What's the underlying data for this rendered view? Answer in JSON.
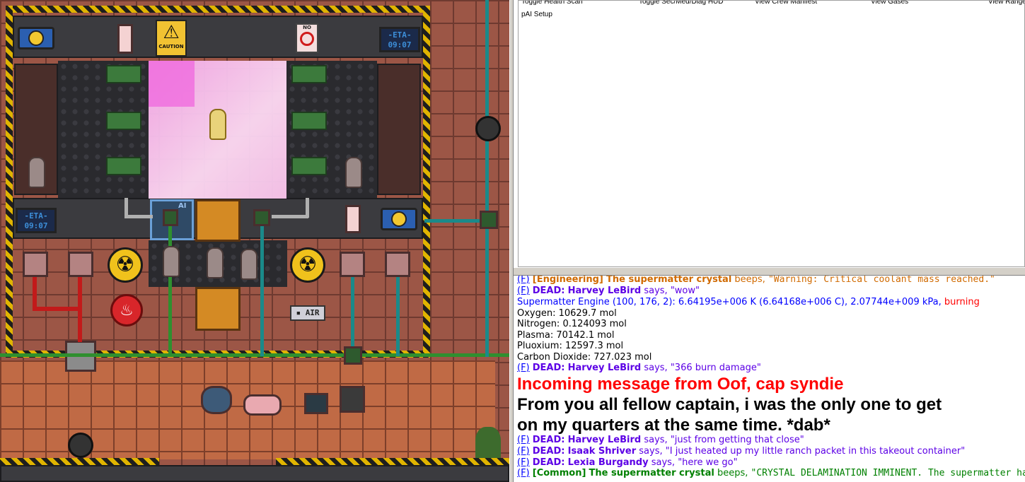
{
  "game": {
    "eta_label": "ETA",
    "eta_time": "09:07",
    "caution_label": "CAUTION",
    "no_smoking_label": "NO",
    "air_label": "AIR",
    "ai_label": "AI"
  },
  "verbs": {
    "row1": [
      "Toggle Health Scan",
      "Toggle Sec/Med/Diag HUD",
      "View Crew Manifest",
      "View Gases",
      "View Range"
    ],
    "row2": [
      "pAI Setup"
    ]
  },
  "chat": {
    "f_link": "(F)",
    "dead_prefix": "DEAD:",
    "msg1_channel": "[Engineering]",
    "msg1_speaker": "The supermatter crystal",
    "msg1_verb": "beeps,",
    "msg1_text": "\"Warning: Critical coolant mass reached.\"",
    "msg2_name": "Harvey LeBird",
    "msg2_verb": "says,",
    "msg2_text": "\"wow\"",
    "scan_head": "Supermatter Engine (100, 176, 2): 6.64195e+006 K (6.64168e+006 C), 2.07744e+009 kPa,",
    "scan_status": "burning",
    "gases": [
      "Oxygen: 10629.7 mol",
      "Nitrogen: 0.124093 mol",
      "Plasma: 70142.1 mol",
      "Pluoxium: 12597.3 mol",
      "Carbon Dioxide: 727.023 mol"
    ],
    "msg3_name": "Harvey LeBird",
    "msg3_verb": "says,",
    "msg3_text": "\"366 burn damage\"",
    "incoming": "Incoming message from Oof, cap syndie",
    "announce_l1": "From you all fellow captain, i was the only one to get",
    "announce_l2": "on my quarters at the same time. *dab*",
    "msg4_name": "Harvey LeBird",
    "msg4_verb": "says,",
    "msg4_text": "\"just from getting that close\"",
    "msg5_name": "Isaak Shriver",
    "msg5_verb": "says,",
    "msg5_text": "\"I just heated up my little ranch packet in this takeout container\"",
    "msg6_name": "Lexia Burgandy",
    "msg6_verb": "says,",
    "msg6_text": "\"here we go\"",
    "msg7_channel": "[Common]",
    "msg7_speaker": "The supermatter crystal",
    "msg7_verb": "beeps,",
    "msg7_text": "\"CRYSTAL DELAMINATION IMMINENT. The supermatter ha"
  },
  "colors": {
    "dead": "#5c00e6",
    "engineering": "#d06a00",
    "common": "#008000",
    "incoming": "#ff0000",
    "link": "#0000ff"
  }
}
